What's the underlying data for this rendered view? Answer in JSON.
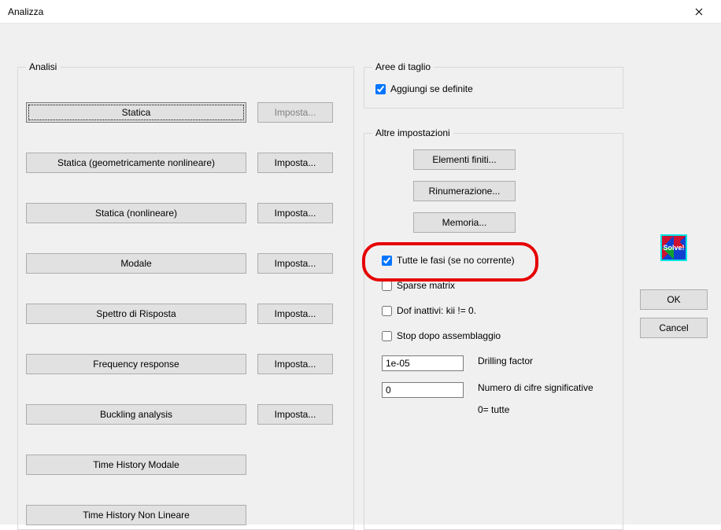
{
  "window": {
    "title": "Analizza"
  },
  "analisi": {
    "legend": "Analisi",
    "rows": [
      {
        "label": "Statica",
        "imposta": "Imposta...",
        "imposta_disabled": true
      },
      {
        "label": "Statica (geometricamente nonlineare)",
        "imposta": "Imposta..."
      },
      {
        "label": "Statica (nonlineare)",
        "imposta": "Imposta..."
      },
      {
        "label": "Modale",
        "imposta": "Imposta..."
      },
      {
        "label": "Spettro di Risposta",
        "imposta": "Imposta..."
      },
      {
        "label": "Frequency response",
        "imposta": "Imposta..."
      },
      {
        "label": "Buckling analysis",
        "imposta": "Imposta..."
      }
    ],
    "singles": [
      "Time History Modale",
      "Time History Non Lineare"
    ]
  },
  "aree": {
    "legend": "Aree di taglio",
    "aggiungi": {
      "label": "Aggiungi se definite",
      "checked": true
    }
  },
  "altre": {
    "legend": "Altre impostazioni",
    "buttons": {
      "elementi": "Elementi finiti...",
      "rinumerazione": "Rinumerazione...",
      "memoria": "Memoria..."
    },
    "checks": {
      "tutte_fasi": {
        "label": "Tutte le fasi (se no corrente)",
        "checked": true
      },
      "sparse": {
        "label": "Sparse matrix",
        "checked": false
      },
      "dof": {
        "label": "Dof inattivi: kii != 0.",
        "checked": false
      },
      "stop": {
        "label": "Stop dopo assemblaggio",
        "checked": false
      }
    },
    "inputs": {
      "drilling": {
        "value": "1e-05",
        "label": "Drilling factor"
      },
      "cifre": {
        "value": "0",
        "label": "Numero di cifre significative",
        "sublabel": "0= tutte"
      }
    }
  },
  "side": {
    "solve": "Solve!",
    "ok": "OK",
    "cancel": "Cancel"
  }
}
